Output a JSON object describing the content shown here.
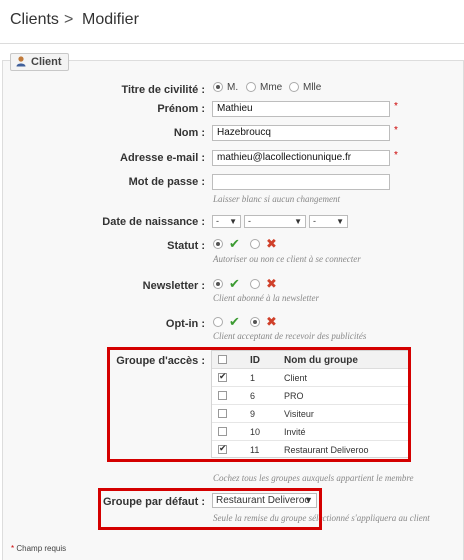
{
  "header": {
    "crumb": "Clients",
    "separator": ">",
    "title": "Modifier"
  },
  "section": {
    "legend": "Client",
    "icon": "user-icon"
  },
  "form": {
    "civility": {
      "label": "Titre de civilité :",
      "options": [
        "M.",
        "Mme",
        "Mlle"
      ],
      "selected": "M."
    },
    "firstname": {
      "label": "Prénom :",
      "value": "Mathieu",
      "required": "*"
    },
    "lastname": {
      "label": "Nom :",
      "value": "Hazebroucq",
      "required": "*"
    },
    "email": {
      "label": "Adresse e-mail :",
      "value": "mathieu@lacollectionunique.fr",
      "required": "*"
    },
    "password": {
      "label": "Mot de passe :",
      "value": "",
      "help": "Laisser blanc si aucun changement"
    },
    "birthday": {
      "label": "Date de naissance :",
      "day": "-",
      "month": "-",
      "year": "-"
    },
    "status": {
      "label": "Statut :",
      "yes_selected": true,
      "help": "Autoriser ou non ce client à se connecter"
    },
    "newsletter": {
      "label": "Newsletter :",
      "yes_selected": true,
      "help": "Client abonné à la newsletter"
    },
    "optin": {
      "label": "Opt-in :",
      "yes_selected": false,
      "help": "Client acceptant de recevoir des publicités"
    },
    "groups": {
      "label": "Groupe d'accès :",
      "col_id": "ID",
      "col_name": "Nom du groupe",
      "rows": [
        {
          "id": "1",
          "name": "Client",
          "checked": true
        },
        {
          "id": "6",
          "name": "PRO",
          "checked": false
        },
        {
          "id": "9",
          "name": "Visiteur",
          "checked": false
        },
        {
          "id": "10",
          "name": "Invité",
          "checked": false
        },
        {
          "id": "11",
          "name": "Restaurant Deliveroo",
          "checked": true
        }
      ],
      "help": "Cochez tous les groupes auxquels appartient le membre"
    },
    "default_group": {
      "label": "Groupe par défaut :",
      "value": "Restaurant Deliveroo",
      "help": "Seule la remise du groupe sélectionné s'appliquera au client"
    }
  },
  "footer": {
    "required_note": "Champ requis",
    "star": "*"
  },
  "colors": {
    "check": "#3c9b32",
    "cross": "#d0402a",
    "highlight": "#d40000"
  }
}
